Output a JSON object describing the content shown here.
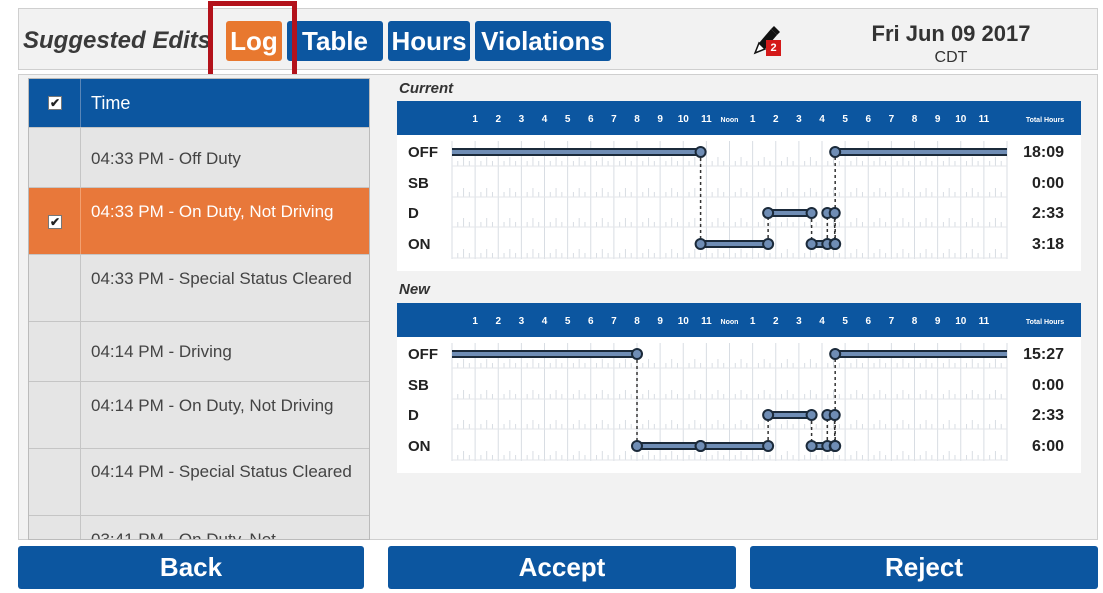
{
  "header": {
    "title": "Suggested Edits",
    "tabs": [
      {
        "label": "Log",
        "active": true
      },
      {
        "label": "Table",
        "active": false
      },
      {
        "label": "Hours",
        "active": false
      },
      {
        "label": "Violations",
        "active": false
      }
    ],
    "edit_badge_count": "2",
    "date": "Fri Jun 09 2017",
    "timezone": "CDT"
  },
  "events": {
    "column_header": "Time",
    "header_checked": true,
    "rows": [
      {
        "text": "04:33 PM - Off Duty",
        "checked": false,
        "selected": false
      },
      {
        "text": "04:33 PM - On Duty, Not Driving",
        "checked": true,
        "selected": true
      },
      {
        "text": "04:33 PM - Special Status Cleared",
        "checked": false,
        "selected": false
      },
      {
        "text": "04:14 PM - Driving",
        "checked": false,
        "selected": false
      },
      {
        "text": "04:14 PM - On Duty, Not Driving",
        "checked": false,
        "selected": false
      },
      {
        "text": "04:14 PM - Special Status Cleared",
        "checked": false,
        "selected": false
      },
      {
        "text": "03:41 PM - On Duty, Not",
        "checked": false,
        "selected": false
      }
    ]
  },
  "logs": {
    "hour_labels": [
      "1",
      "2",
      "3",
      "4",
      "5",
      "6",
      "7",
      "8",
      "9",
      "10",
      "11",
      "Noon",
      "1",
      "2",
      "3",
      "4",
      "5",
      "6",
      "7",
      "8",
      "9",
      "10",
      "11"
    ],
    "total_label": "Total Hours",
    "status_labels": [
      "OFF",
      "SB",
      "D",
      "ON"
    ],
    "graphs": [
      {
        "label": "Current",
        "totals": [
          "18:09",
          "0:00",
          "2:33",
          "3:18"
        ],
        "segments": [
          {
            "status": "OFF",
            "start": 0,
            "end": 10.75
          },
          {
            "status": "ON",
            "start": 10.75,
            "end": 13.67
          },
          {
            "status": "D",
            "start": 13.67,
            "end": 15.55
          },
          {
            "status": "ON",
            "start": 15.55,
            "end": 16.23
          },
          {
            "status": "D",
            "start": 16.23,
            "end": 16.55
          },
          {
            "status": "ON",
            "start": 16.55,
            "end": 16.57
          },
          {
            "status": "OFF",
            "start": 16.57,
            "end": 24
          }
        ]
      },
      {
        "label": "New",
        "totals": [
          "15:27",
          "0:00",
          "2:33",
          "6:00"
        ],
        "segments": [
          {
            "status": "OFF",
            "start": 0,
            "end": 8.0
          },
          {
            "status": "ON",
            "start": 8.0,
            "end": 10.75
          },
          {
            "status": "ON",
            "start": 10.75,
            "end": 13.67
          },
          {
            "status": "D",
            "start": 13.67,
            "end": 15.55
          },
          {
            "status": "ON",
            "start": 15.55,
            "end": 16.23
          },
          {
            "status": "D",
            "start": 16.23,
            "end": 16.55
          },
          {
            "status": "ON",
            "start": 16.55,
            "end": 16.57
          },
          {
            "status": "OFF",
            "start": 16.57,
            "end": 24
          }
        ]
      }
    ]
  },
  "actions": {
    "back": "Back",
    "accept": "Accept",
    "reject": "Reject"
  },
  "colors": {
    "primary": "#0c56a0",
    "accent": "#e8782f",
    "highlight": "#b3121b",
    "line": "#1b2a3a",
    "line_fill": "#6f8db5"
  }
}
